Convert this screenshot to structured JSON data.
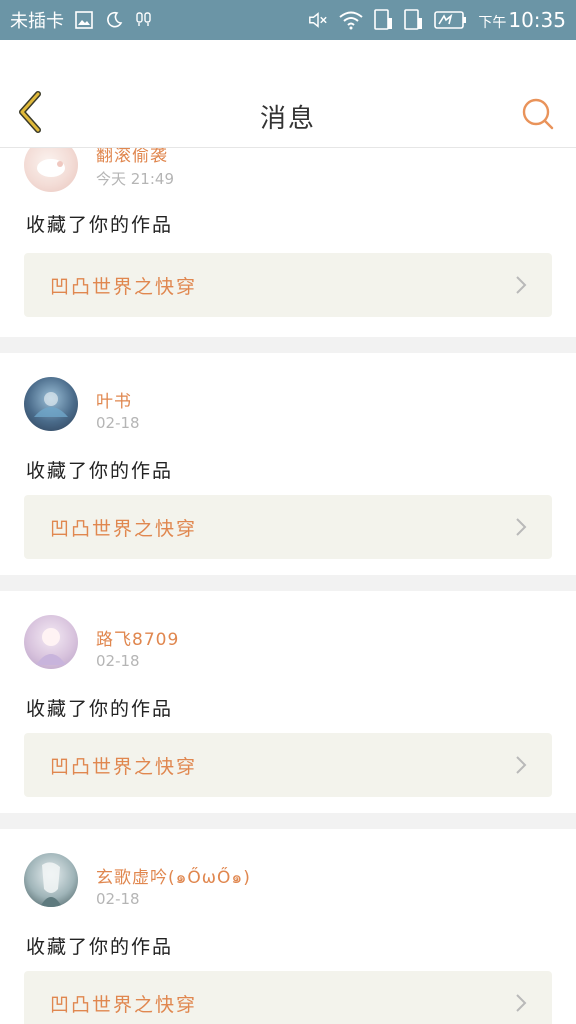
{
  "status_bar": {
    "carrier": "未插卡",
    "ampm": "下午",
    "time": "10:35"
  },
  "header": {
    "title": "消息"
  },
  "notifications": [
    {
      "user": "翻滚偷袭",
      "time": "今天 21:49",
      "message": "收藏了你的作品",
      "work": "凹凸世界之快穿"
    },
    {
      "user": "叶书",
      "time": "02-18",
      "message": "收藏了你的作品",
      "work": "凹凸世界之快穿"
    },
    {
      "user": "路飞8709",
      "time": "02-18",
      "message": "收藏了你的作品",
      "work": "凹凸世界之快穿"
    },
    {
      "user": "玄歌虚吟(๑ŐωŐ๑)",
      "time": "02-18",
      "message": "收藏了你的作品",
      "work": "凹凸世界之快穿"
    }
  ],
  "colors": {
    "status_bar": "#6b95a6",
    "accent": "#e0874f",
    "back_arrow": "#e0b93a"
  }
}
